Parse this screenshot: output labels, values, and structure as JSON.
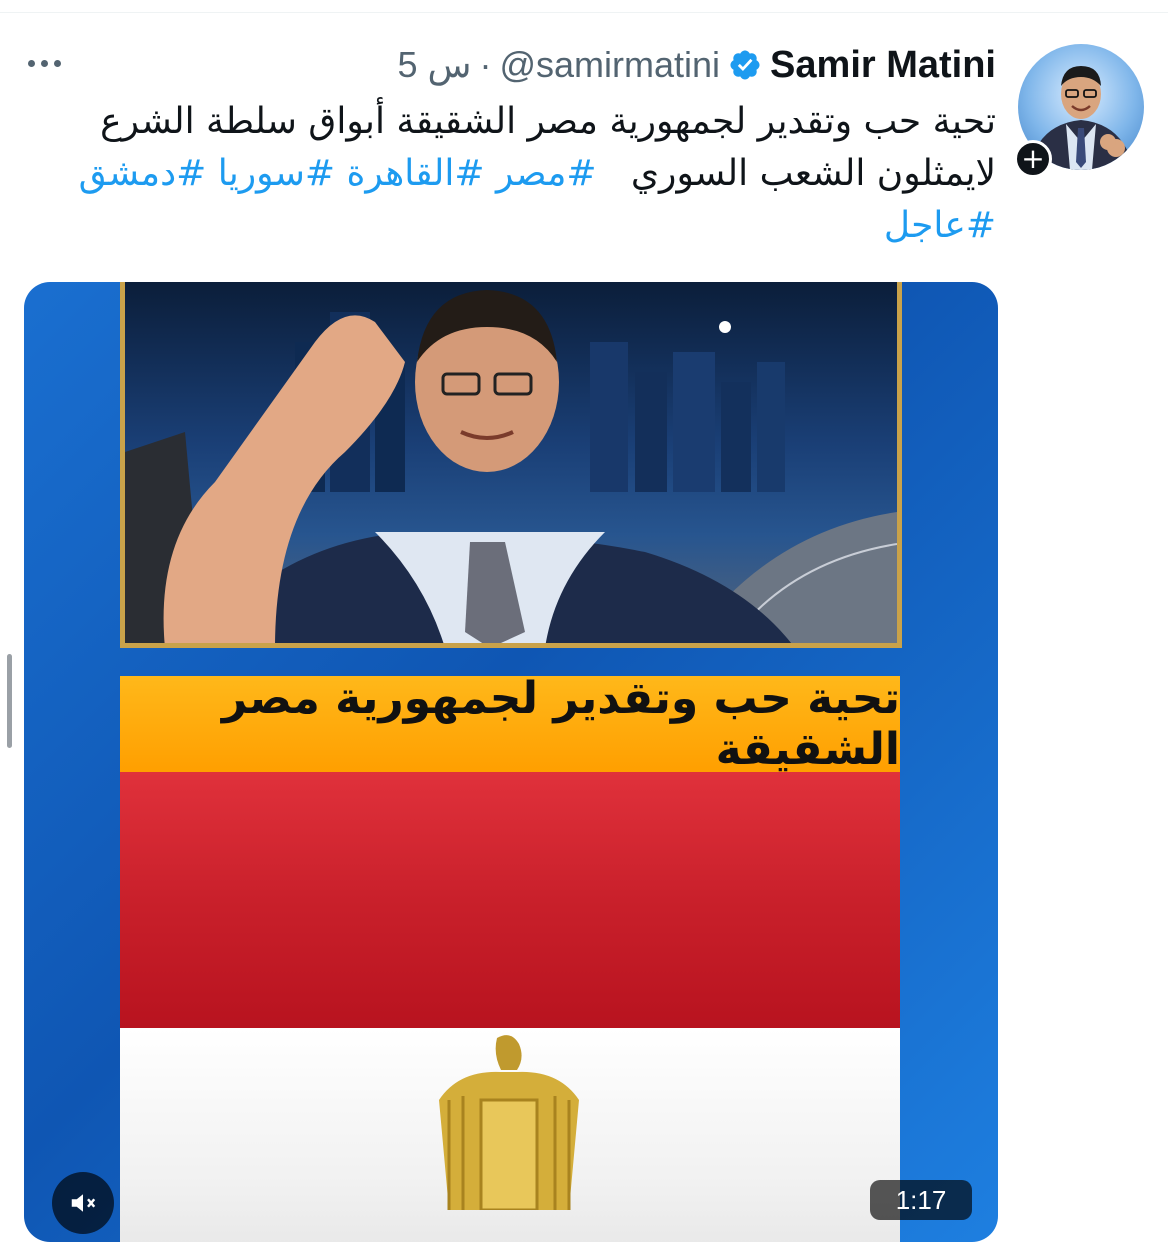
{
  "tweet": {
    "author_name": "Samir Matini",
    "handle": "@samirmatini",
    "separator": "·",
    "time": "5 س",
    "text_line1": "تحية حب وتقدير لجمهورية مصر الشقيقة أبواق سلطة الشرع",
    "text_line2_plain": "لايمثلون الشعب السوري",
    "hashtag_masr": "#مصر",
    "hashtag_cairo": "#القاهرة",
    "hashtag_syria": "#سوريا",
    "hashtag_damascus": "#دمشق",
    "hashtag_urgent": "#عاجل",
    "verified": true
  },
  "media": {
    "banner_text": "تحية حب وتقدير لجمهورية مصر الشقيقة",
    "duration": "1:17"
  },
  "icons": {
    "more": "more-dots-icon",
    "verified": "verified-badge-icon",
    "follow": "plus-icon",
    "mute": "speaker-muted-icon"
  },
  "colors": {
    "accent": "#1d9bf0",
    "text": "#0f1419",
    "secondary": "#536471",
    "banner": "#ffa500",
    "flag_red": "#ce1126"
  }
}
